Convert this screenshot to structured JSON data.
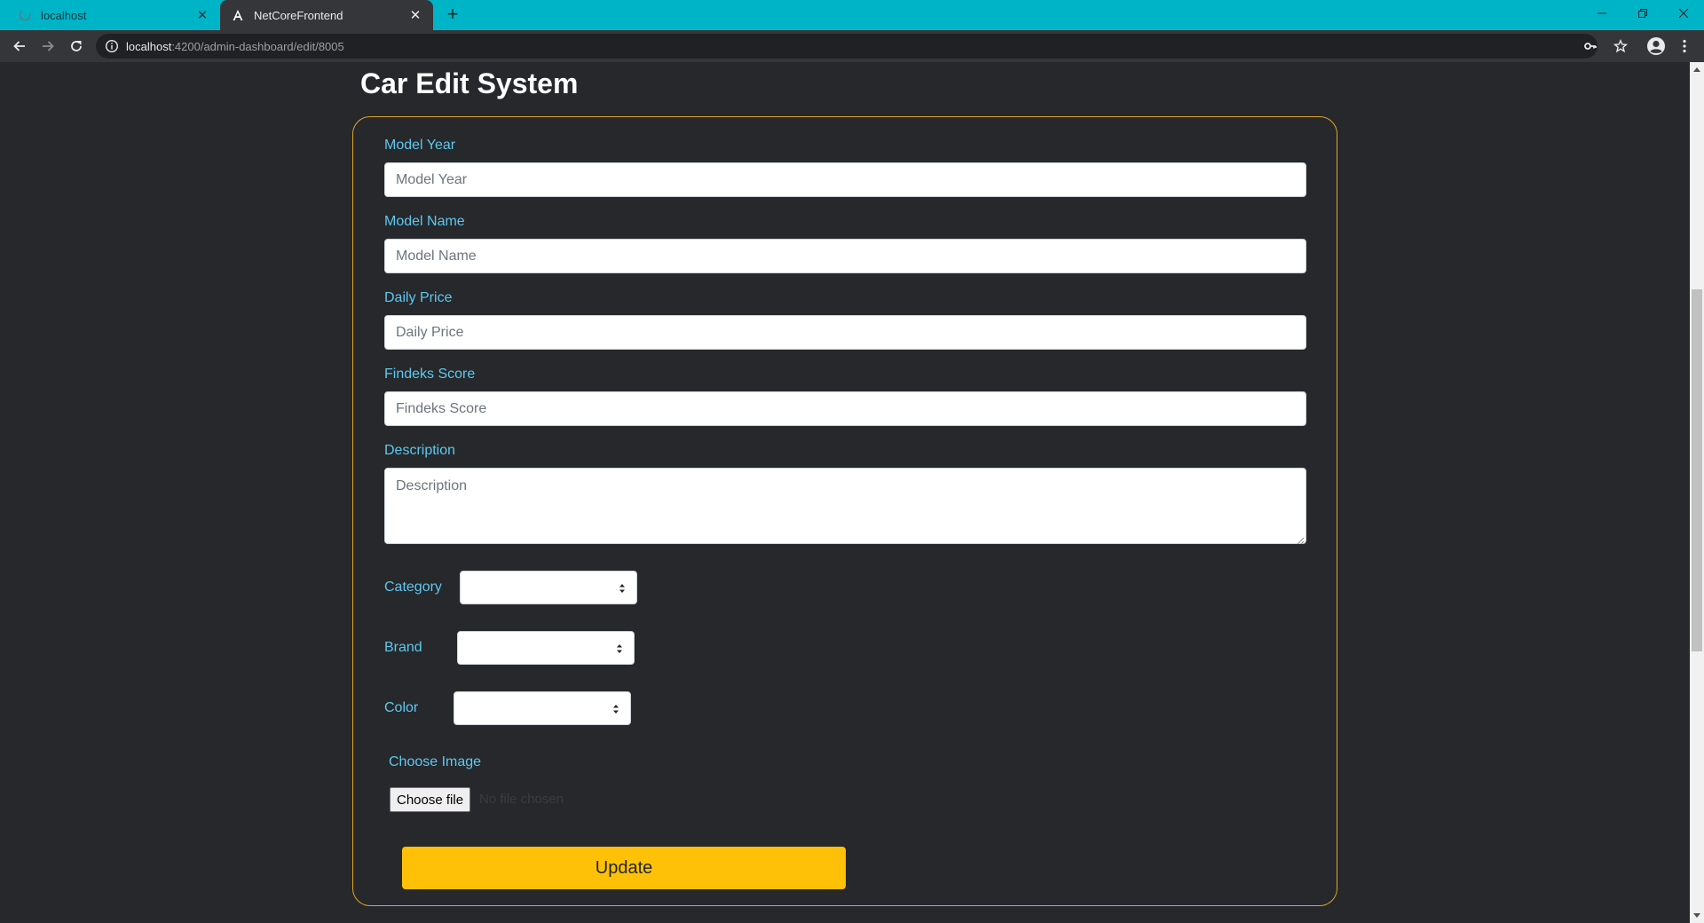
{
  "browser": {
    "tabs": [
      {
        "title": "localhost",
        "active": false,
        "icon": "spinner-icon"
      },
      {
        "title": "NetCoreFrontend",
        "active": true,
        "icon": "angular-icon"
      }
    ],
    "address": {
      "host": "localhost",
      "path": ":4200/admin-dashboard/edit/8005"
    },
    "tab_strip_color": "#00b4c8"
  },
  "page": {
    "title": "Car Edit System",
    "accent_border": "#e0a526",
    "label_color": "#5ec8f0"
  },
  "form": {
    "model_year": {
      "label": "Model Year",
      "placeholder": "Model Year"
    },
    "model_name": {
      "label": "Model Name",
      "placeholder": "Model Name"
    },
    "daily_price": {
      "label": "Daily Price",
      "placeholder": "Daily Price"
    },
    "findeks_score": {
      "label": "Findeks Score",
      "placeholder": "Findeks Score"
    },
    "description": {
      "label": "Description",
      "placeholder": "Description"
    },
    "category": {
      "label": "Category",
      "value": ""
    },
    "brand": {
      "label": "Brand",
      "value": ""
    },
    "color": {
      "label": "Color",
      "value": ""
    },
    "image": {
      "label": "Choose Image",
      "button": "Choose file",
      "status": "No file chosen"
    },
    "submit": {
      "label": "Update",
      "color": "#ffc107"
    }
  }
}
